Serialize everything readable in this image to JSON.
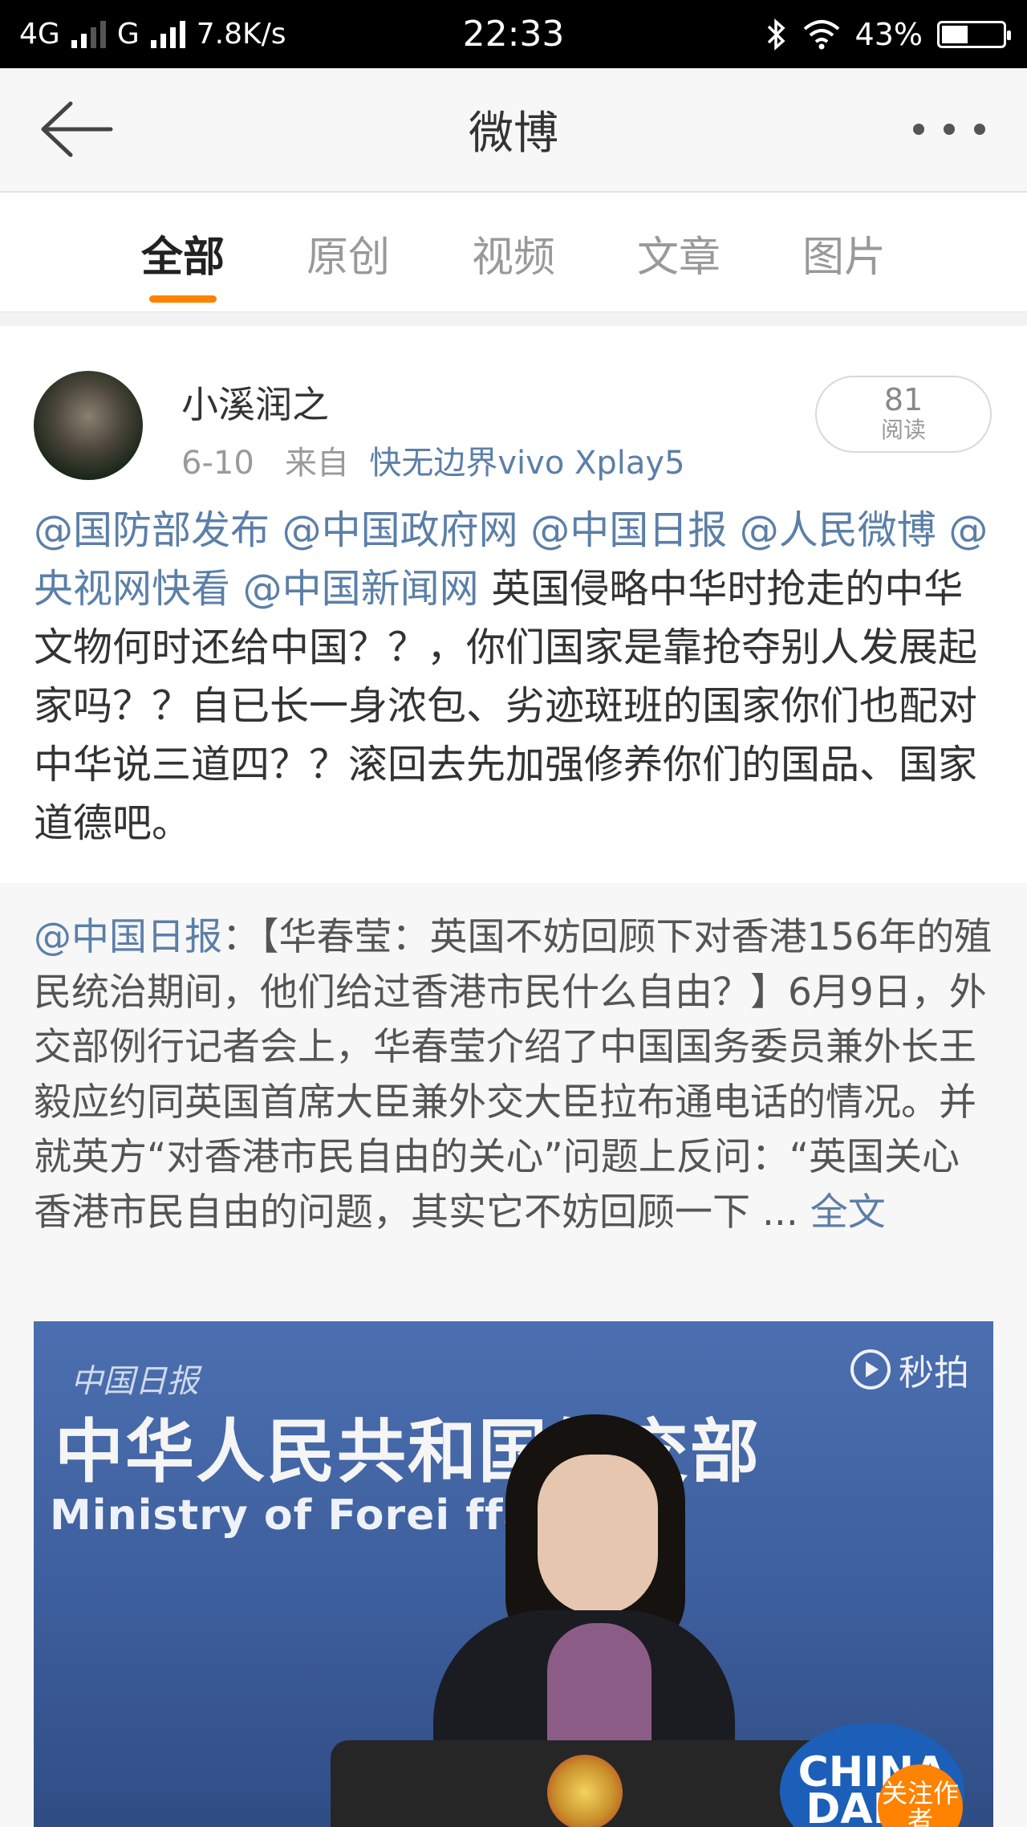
{
  "status_bar": {
    "network_1": "4G",
    "network_2": "G",
    "speed": "7.8K/s",
    "time": "22:33",
    "battery": "43%",
    "battery_level": 0.43,
    "icons": [
      "signal-icon",
      "bluetooth-icon",
      "wifi-icon",
      "battery-icon"
    ]
  },
  "nav": {
    "title": "微博",
    "back_icon": "back-arrow-icon",
    "more_icon": "more-icon"
  },
  "tabs": [
    {
      "label": "全部",
      "active": true
    },
    {
      "label": "原创",
      "active": false
    },
    {
      "label": "视频",
      "active": false
    },
    {
      "label": "文章",
      "active": false
    },
    {
      "label": "图片",
      "active": false
    }
  ],
  "colors": {
    "accent": "#ff8200",
    "link": "#5b7fa8",
    "text": "#333333"
  },
  "post": {
    "author": "小溪润之",
    "date": "6-10",
    "from_label": "来自",
    "source": "快无边界vivo Xplay5",
    "reads_count": "81",
    "reads_label": "阅读",
    "mentions": [
      "@国防部发布",
      "@中国政府网",
      "@中国日报",
      "@人民微博",
      "@央视网快看",
      "@中国新闻网"
    ],
    "text": "英国侵略中华时抢走的中华文物何时还给中国？？，你们国家是靠抢夺别人发展起家吗？？自已长一身浓包、劣迹斑班的国家你们也配对中华说三道四？？滚回去先加强修养你们的国品、国家道德吧。"
  },
  "repost": {
    "mention": "@中国日报",
    "text": "：【华春莹：英国不妨回顾下对香港156年的殖民统治期间，他们给过香港市民什么自由？】6月9日，外交部例行记者会上，华春莹介绍了中国国务委员兼外长王毅应约同英国首席大臣兼外交大臣拉布通电话的情况。并就英方“对香港市民自由的关心”问题上反问：“英国关心香港市民自由的问题，其实它不妨回顾一下 ...",
    "full_text_link": "全文"
  },
  "video": {
    "watermark_top_left": "中国日报",
    "watermark_top_right": "秒拍",
    "sign_cn": "中华人民共和国外交部",
    "sign_en": "Ministry of Forei   ffairs",
    "logo_text": "CHINA DAILY",
    "follow_badge": "关注作者"
  }
}
